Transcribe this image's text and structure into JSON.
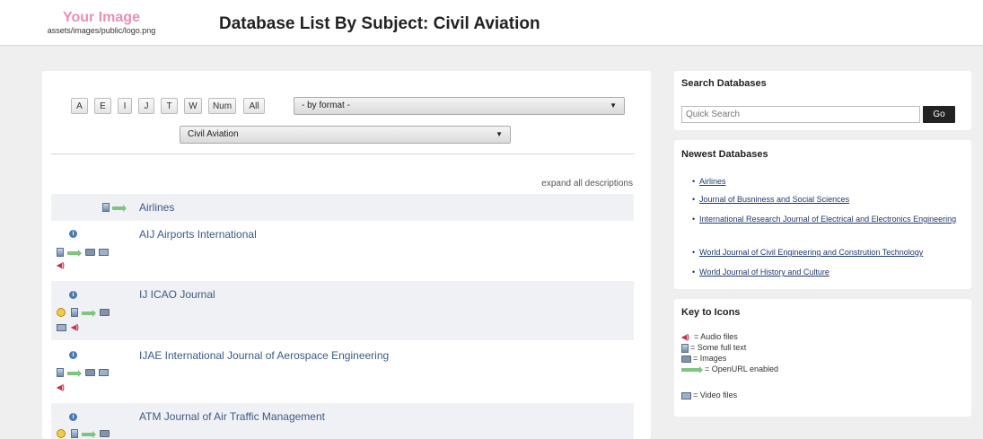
{
  "header": {
    "logo_title": "Your Image",
    "logo_path": "assets/images/public/logo.png",
    "page_title": "Database List By Subject: Civil Aviation"
  },
  "filters": {
    "letters": [
      "A",
      "E",
      "I",
      "J",
      "T",
      "W",
      "Num",
      "All"
    ],
    "format_select": "- by format -",
    "subject_select": "Civil Aviation"
  },
  "list": {
    "expand_all": "expand all descriptions",
    "databases": [
      {
        "name": "Airlines",
        "icons": [
          "doc-icon",
          "openurl-arrow-icon"
        ]
      },
      {
        "name": "AIJ Airports International",
        "icons": [
          "info-icon",
          "doc-icon",
          "openurl-arrow-icon",
          "images-icon",
          "video-icon",
          "audio-icon"
        ]
      },
      {
        "name": "IJ ICAO Journal",
        "icons": [
          "info-icon",
          "face-icon",
          "doc-icon",
          "openurl-arrow-icon",
          "images-icon",
          "video-icon",
          "audio-icon"
        ]
      },
      {
        "name": "IJAE International Journal of Aerospace Engineering",
        "icons": [
          "info-icon",
          "doc-icon",
          "openurl-arrow-icon",
          "images-icon",
          "video-icon",
          "audio-icon"
        ]
      },
      {
        "name": "ATM Journal of Air Traffic Management",
        "icons": [
          "info-icon",
          "face-icon",
          "doc-icon",
          "openurl-arrow-icon",
          "images-icon"
        ]
      }
    ]
  },
  "sidebar": {
    "search": {
      "title": "Search Databases",
      "placeholder": "Quick Search",
      "go_label": "Go"
    },
    "newest": {
      "title": "Newest Databases",
      "items": [
        "Airlines",
        "Journal of Busniness and Social Sciences",
        "International Research Journal of Electrical and Electronics Engineering",
        "World Journal of Civil Engineering and Constrution Technology",
        "World Journal of History and Culture"
      ]
    },
    "key": {
      "title": "Key to Icons",
      "audio": "= Audio files",
      "fulltext": "= Some full text",
      "images": "= Images",
      "openurl": "= OpenURL enabled",
      "video": "= Video files"
    }
  },
  "colors": {
    "link": "#3b5a86",
    "logo": "#e98fb4",
    "go_button": "#222222",
    "row_shade": "#f0f1f4"
  }
}
